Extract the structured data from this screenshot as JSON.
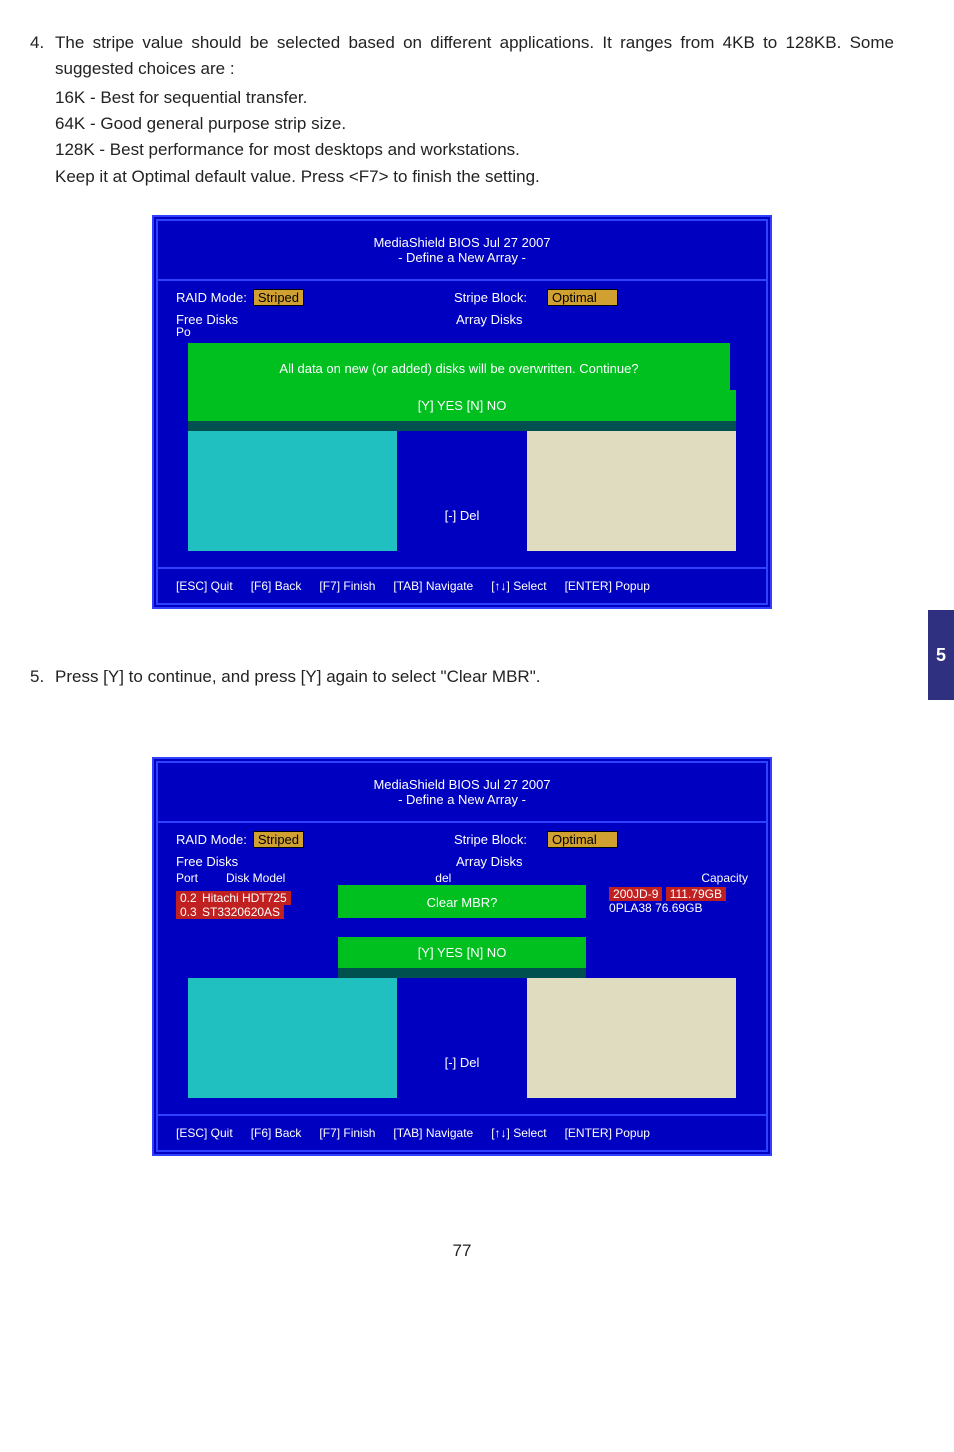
{
  "side_tab": "5",
  "page_number": "77",
  "step4": {
    "num": "4.",
    "body": "The stripe value should be selected based on different applications. It ranges from 4KB to 128KB. Some suggested choices are :",
    "l1": "16K - Best for sequential transfer.",
    "l2": "64K - Good general purpose strip size.",
    "l3": "128K - Best performance for most desktops and workstations.",
    "l4": "Keep it at Optimal default value. Press <F7> to finish the setting.",
    "l5": ""
  },
  "step5": {
    "num": "5.",
    "body": "Press [Y] to continue, and press [Y] again to select \"Clear MBR\"."
  },
  "bios1": {
    "title": "MediaShield BIOS   Jul 27 2007",
    "subtitle": "- Define a New Array -",
    "raid_label": "RAID Mode:",
    "raid_value": "Striped",
    "stripe_label": "Stripe Block:",
    "stripe_value": "Optimal",
    "free_disks": "Free Disks",
    "array_disks": "Array Disks",
    "p_cut": "Po",
    "overwrite": "All data on new (or added) disks will be overwritten. Continue?",
    "yesno": "[Y] YES  [N] NO",
    "del": "[-] Del",
    "foot": {
      "esc": "[ESC] Quit",
      "f6": "[F6] Back",
      "f7": "[F7] Finish",
      "tab": "[TAB] Navigate",
      "sel": "[↑↓] Select",
      "ent": "[ENTER] Popup"
    }
  },
  "bios2": {
    "title": "MediaShield BIOS   Jul 27 2007",
    "subtitle": "- Define a New Array -",
    "raid_label": "RAID Mode:",
    "raid_value": "Striped",
    "stripe_label": "Stripe Block:",
    "stripe_value": "Optimal",
    "free_disks": "Free Disks",
    "array_disks": "Array Disks",
    "port_hdr": "Port",
    "model_hdr": "Disk Model",
    "del_hdr": "del",
    "cap_hdr": "Capacity",
    "disks": [
      {
        "port": "0.2",
        "model": "Hitachi HDT725"
      },
      {
        "port": "0.3",
        "model": "ST3320620AS"
      }
    ],
    "rdisks": [
      {
        "model": "200JD-9",
        "cap": "111.79GB"
      },
      {
        "model": "0PLA38",
        "cap": "76.69GB"
      }
    ],
    "clear_mbr": "Clear MBR?",
    "yesno": "[Y] YES  [N] NO",
    "del": "[-] Del",
    "foot": {
      "esc": "[ESC] Quit",
      "f6": "[F6] Back",
      "f7": "[F7] Finish",
      "tab": "[TAB] Navigate",
      "sel": "[↑↓] Select",
      "ent": "[ENTER] Popup"
    }
  }
}
